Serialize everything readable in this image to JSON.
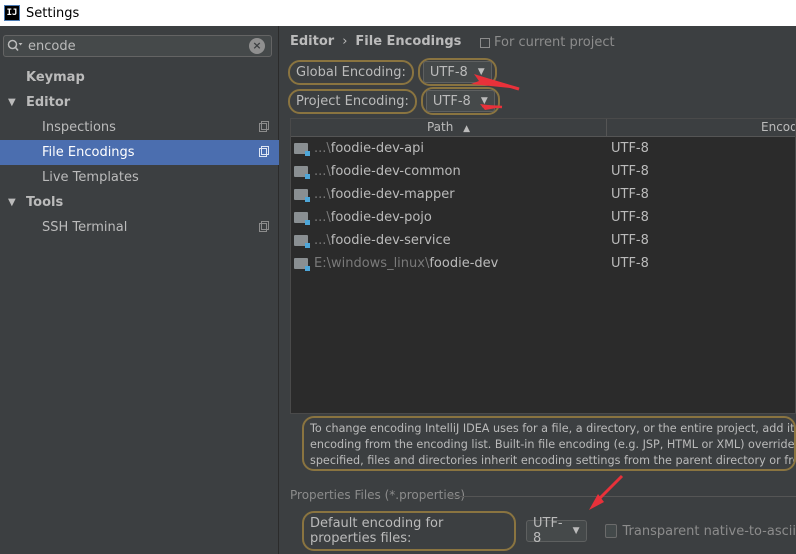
{
  "window": {
    "title": "Settings",
    "app_icon_text": "IJ"
  },
  "sidebar": {
    "search_value": "encode",
    "items": [
      {
        "label": "Keymap"
      },
      {
        "label": "Editor"
      },
      {
        "label": "Inspections"
      },
      {
        "label": "File Encodings"
      },
      {
        "label": "Live Templates"
      },
      {
        "label": "Tools"
      },
      {
        "label": "SSH Terminal"
      }
    ]
  },
  "main": {
    "breadcrumb": {
      "root": "Editor",
      "separator": "›",
      "current": "File Encodings"
    },
    "scope_label": "For current project",
    "global_encoding": {
      "label": "Global Encoding:",
      "value": "UTF-8"
    },
    "project_encoding": {
      "label": "Project Encoding:",
      "value": "UTF-8"
    },
    "table": {
      "columns": {
        "path": "Path",
        "sort_indicator": "▲",
        "encoding": "Encoding"
      },
      "rows": [
        {
          "prefix": "...\\",
          "name": "foodie-dev-api",
          "encoding": "UTF-8"
        },
        {
          "prefix": "...\\",
          "name": "foodie-dev-common",
          "encoding": "UTF-8"
        },
        {
          "prefix": "...\\",
          "name": "foodie-dev-mapper",
          "encoding": "UTF-8"
        },
        {
          "prefix": "...\\",
          "name": "foodie-dev-pojo",
          "encoding": "UTF-8"
        },
        {
          "prefix": "...\\",
          "name": "foodie-dev-service",
          "encoding": "UTF-8"
        },
        {
          "prefix": "E:\\windows_linux\\",
          "name": "foodie-dev",
          "encoding": "UTF-8"
        }
      ]
    },
    "info_lines": [
      "To change encoding IntelliJ IDEA uses for a file, a directory, or the entire project, add its path",
      "encoding from the encoding list. Built-in file encoding (e.g. JSP, HTML or XML) overrides enc",
      "specified, files and directories inherit encoding settings from the parent directory or from the"
    ],
    "properties": {
      "section_title": "Properties Files (*.properties)",
      "default_label": "Default encoding for properties files:",
      "default_value": "UTF-8",
      "transparent_label": "Transparent native-to-ascii"
    }
  },
  "colors": {
    "selection": "#4b6eaf",
    "highlight_ring": "#8a7440",
    "annotation_arrow": "#e8313a"
  }
}
